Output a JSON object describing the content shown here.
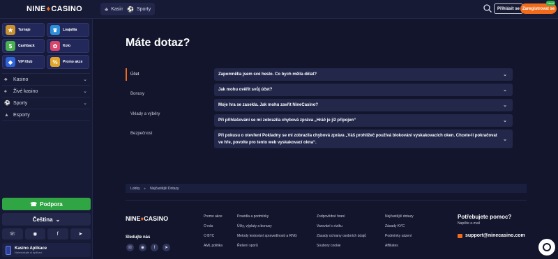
{
  "header": {
    "logo_left": "NINE",
    "logo_right": "CASINO",
    "tabs": [
      {
        "icon": "cards-icon",
        "label": "Kasino"
      },
      {
        "icon": "soccer-ball-icon",
        "label": "Sporty"
      }
    ],
    "login_label": "Přihlásit se",
    "register_label": "Zaregistrovat se",
    "new_badge": "Nové"
  },
  "sidebar": {
    "promos": [
      {
        "label": "Turnaje",
        "icon": "trophy-icon",
        "color": "#c9912e"
      },
      {
        "label": "Loajalita",
        "icon": "crown-icon",
        "color": "#2d8fd9"
      },
      {
        "label": "Cashback",
        "icon": "money-icon",
        "color": "#4bb04f"
      },
      {
        "label": "Kolo",
        "icon": "wheel-icon",
        "color": "#d9456a"
      },
      {
        "label": "VIP Klub",
        "icon": "vip-icon",
        "color": "#2e64d9"
      },
      {
        "label": "Promo akce",
        "icon": "percent-icon",
        "color": "#e0a52a"
      }
    ],
    "nav": [
      {
        "label": "Kasino",
        "has_chevron": true
      },
      {
        "label": "Živé kasino",
        "has_chevron": true
      },
      {
        "label": "Sporty",
        "has_chevron": true
      },
      {
        "label": "Esporty",
        "has_chevron": false
      }
    ],
    "support_label": "Podpora",
    "language_label": "Čeština",
    "app_title": "Kasino Aplikace",
    "app_subtitle": "Nainstalujte si aplikaci"
  },
  "main": {
    "title": "Máte dotaz?",
    "categories": [
      "Účet",
      "Bonusy",
      "Vklady a výběry",
      "Bezpečnost"
    ],
    "faqs": [
      "Zapomněl/a jsem své heslo. Co bych měl/a dělat?",
      "Jak mohu ověřit svůj účet?",
      "Moje hra se zasekla. Jak mohu zavřít NineCasino?",
      "Při přihlašování se mi zobrazila chybová zpráva „Hráč je již připojen“",
      "Při pokusu o otevření Pokladny se mi zobrazila chybová zpráva „Váš prohlížeč používá blokování vyskakovacích oken. Chcete-li pokračovat ve hře, povolte pro tento web vyskakovací okna“."
    ],
    "breadcrumb": [
      "Lobby",
      "Nejčastější Dotazy"
    ]
  },
  "footer": {
    "follow_label": "Sledujte nás",
    "col1": [
      "Promo akce",
      "O nás",
      "O BTC",
      "AML politika"
    ],
    "col2": [
      "Pravidla a podmínky",
      "Účty, výplaty a bonusy",
      "Metody testování spravedlnosti a RNG",
      "Řešení sporů"
    ],
    "col3": [
      "Zodpovědné hraní",
      "Varování o riziku",
      "Zásady ochrany osobních údajů",
      "Soubory cookie"
    ],
    "col4": [
      "Nejčastější dotazy",
      "Zásady KYC",
      "Podmínky sázení",
      "Affiliates"
    ],
    "help_title": "Potřebujete pomoc?",
    "help_subtitle": "Napište e-mail",
    "help_email": "support@ninecasino.com"
  }
}
